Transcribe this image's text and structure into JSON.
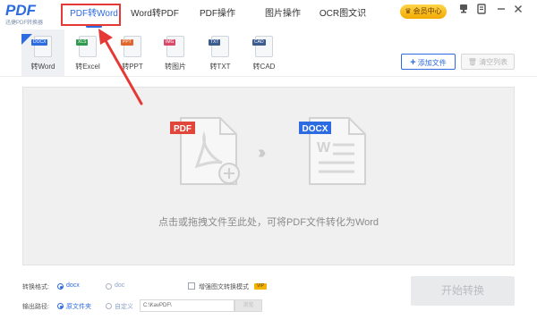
{
  "app": {
    "logo": "PDF",
    "logo_subtitle": "迅捷PDF转换器"
  },
  "nav": {
    "tabs": [
      "PDF转Word",
      "Word转PDF",
      "PDF操作",
      "图片操作",
      "OCR图文识别"
    ],
    "active_index": 0,
    "vip_label": "会员中心"
  },
  "tools": {
    "items": [
      {
        "label": "转Word",
        "tag": "DOCX",
        "tag_color": "#2d6be0"
      },
      {
        "label": "转Excel",
        "tag": "XLS",
        "tag_color": "#2e9b4f"
      },
      {
        "label": "转PPT",
        "tag": "PPT",
        "tag_color": "#e0662d"
      },
      {
        "label": "转图片",
        "tag": "IMG",
        "tag_color": "#d94a6a"
      },
      {
        "label": "转TXT",
        "tag": "TXT",
        "tag_color": "#3b5c8f"
      },
      {
        "label": "转CAD",
        "tag": "CAD",
        "tag_color": "#3b5c8f"
      }
    ],
    "active_index": 0,
    "add_file_label": "添加文件",
    "clear_list_label": "清空列表"
  },
  "dropzone": {
    "source_badge": "PDF",
    "target_badge": "DOCX",
    "hint": "点击或拖拽文件至此处，可将PDF文件转化为Word"
  },
  "options": {
    "format_label": "转换格式:",
    "format_options": [
      "docx",
      "doc"
    ],
    "format_selected": "docx",
    "enhance_label": "增强图文转换模式",
    "enhance_checked": false,
    "vip_tag": "VIP",
    "output_label": "输出路径:",
    "output_options": [
      "原文件夹",
      "自定义"
    ],
    "output_selected": "原文件夹",
    "path_value": "C:\\KavPDF\\",
    "browse_label": "浏览",
    "start_label": "开始转换"
  },
  "colors": {
    "accent": "#2d6be0",
    "annotation": "#e53935",
    "pdf_red": "#e0473a"
  }
}
